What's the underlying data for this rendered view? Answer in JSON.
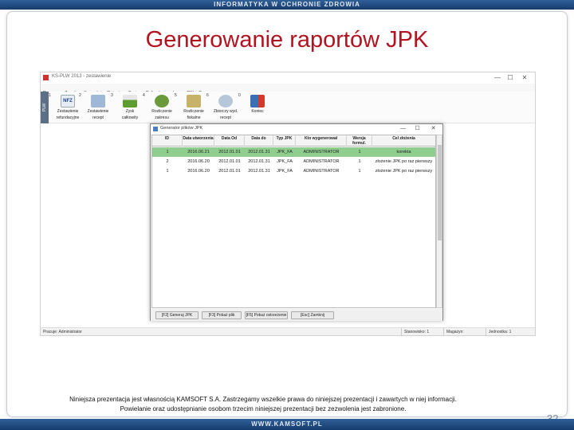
{
  "header": {
    "text": "INFORMATYKA W OCHRONIE ZDROWIA"
  },
  "slide": {
    "title": "Generowanie raportów JPK",
    "footer_line1": "Niniejsza prezentacja jest własnością KAMSOFT S.A. Zastrzegamy wszelkie prawa do niniejszej prezentacji i zawartych w niej informacji.",
    "footer_line2": "Powielanie oraz udostępnianie osobom trzecim niniejszej prezentacji bez zezwolenia jest zabronione.",
    "page_number": "32",
    "bottom_text": "WWW.KAMSOFT.PL"
  },
  "app": {
    "title": "KS-PLW 2013 - zestawienie",
    "window_buttons": {
      "minimize": "—",
      "maximize": "☐",
      "close": "✕"
    },
    "side_tab_label": "PLW",
    "menu": [
      "Program",
      "Zasoby",
      "Sprzedaż",
      "Rejestry",
      "Zapisy",
      "Refundacje",
      "Inne",
      "JPK",
      "Pomoc"
    ],
    "toolbar": [
      {
        "num": "1",
        "label1": "Zestawienie",
        "label2": "refundacyjne",
        "color": "#e8edf5"
      },
      {
        "num": "2",
        "label1": "Zestawienie",
        "label2": "recept",
        "color": "#9fb8d8"
      },
      {
        "num": "3",
        "label1": "Zysk",
        "label2": "całkowity",
        "color": "#8bbf5a"
      },
      {
        "num": "4",
        "label1": "Rozliczenie",
        "label2": "zakresu",
        "color": "#6a9a3a"
      },
      {
        "num": "5",
        "label1": "Rozliczenie",
        "label2": "fiskalne",
        "color": "#c7b26a"
      },
      {
        "num": "6",
        "label1": "Zbiorczy wyd.",
        "label2": "recept",
        "color": "#b7c7da"
      },
      {
        "num": "0",
        "label1": "Koniec",
        "label2": "",
        "color": "#d43a2a"
      }
    ],
    "nfz_badge": "NFZ",
    "status": {
      "user": "Pracuje: Administrator",
      "station": "Stanowisko: 1",
      "store": "Magazyn:",
      "branch": "Jednostka: 1"
    }
  },
  "dialog": {
    "title": "Generator plików JPK",
    "columns": [
      "ID",
      "Data utworzenia",
      "Data Od",
      "Data do",
      "Typ JPK",
      "Kto wygenerował",
      "Wersja formul.",
      "Cel złożenia"
    ],
    "rows": [
      [
        "1",
        "2016.06.21",
        "2012.01.01",
        "2012.01.31",
        "JPK_FA",
        "ADMINISTRATOR",
        "1",
        "korekta"
      ],
      [
        "2",
        "2016.06.20",
        "2012.01.01",
        "2012.01.31",
        "JPK_FA",
        "ADMINISTRATOR",
        "1",
        "złożenie JPK po raz pierwszy"
      ],
      [
        "1",
        "2016.06.20",
        "2012.01.01",
        "2012.01.31",
        "JPK_FA",
        "ADMINISTRATOR",
        "1",
        "złożenie JPK po raz pierwszy"
      ]
    ],
    "selected_row_color": "#8fce8f",
    "footer_buttons": [
      "[F2] Generuj JPK",
      "[F3] Pokaż plik",
      "[F5] Pokaż ostrzeżenie",
      "[Esc] Zamknij"
    ]
  }
}
